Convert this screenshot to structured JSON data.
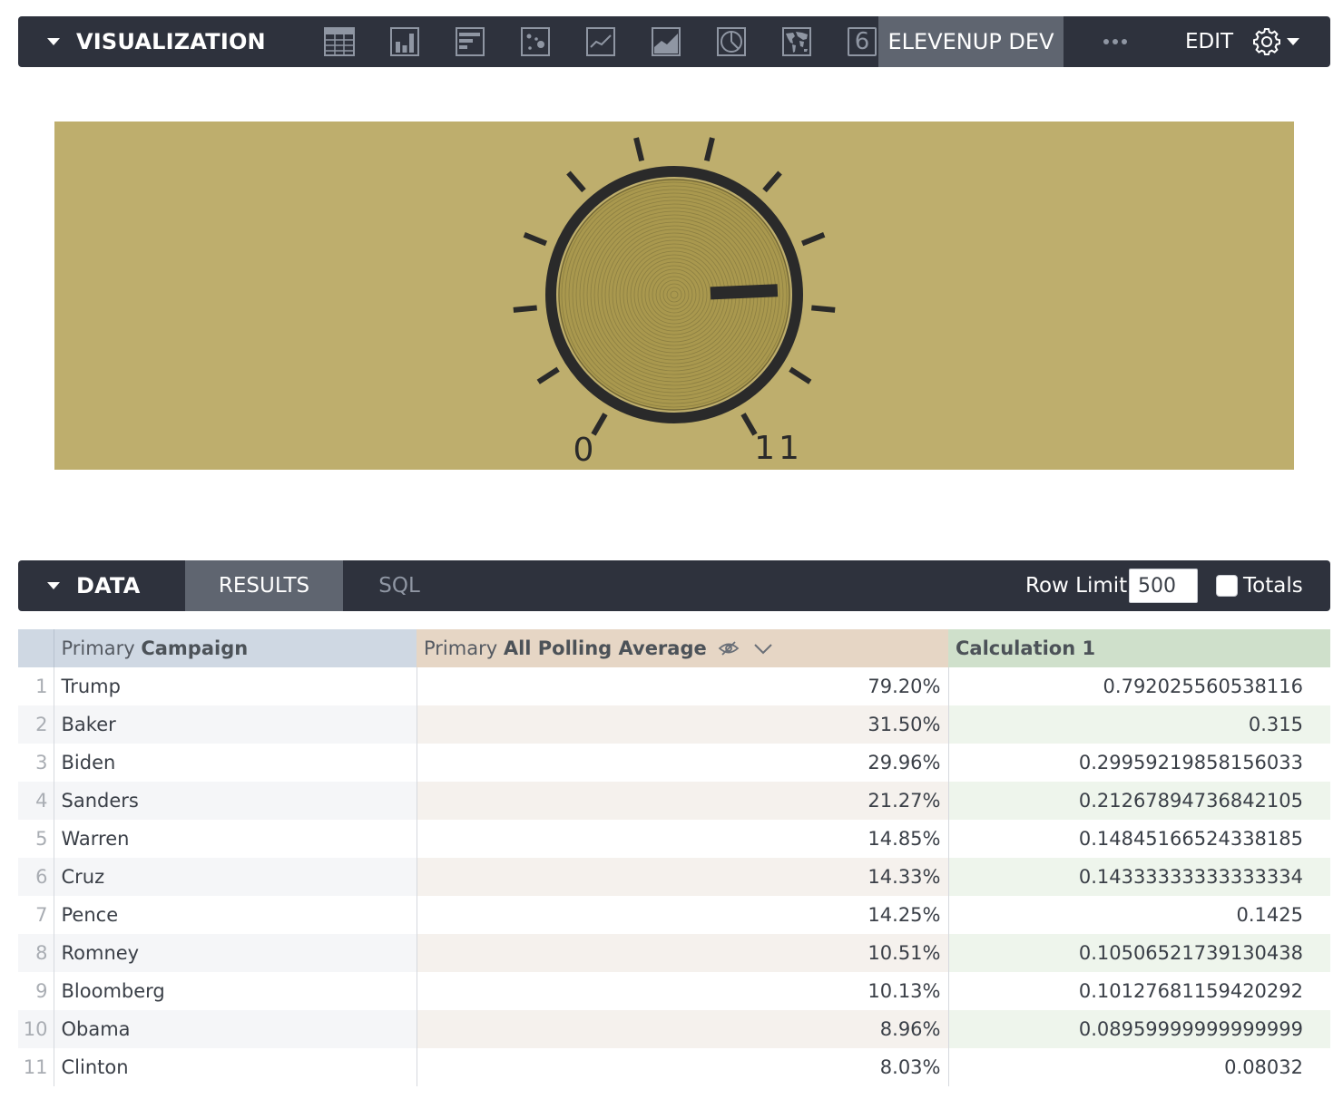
{
  "visualization_bar": {
    "title": "VISUALIZATION",
    "icons": [
      "table-icon",
      "column-chart-icon",
      "bar-chart-icon",
      "scatter-icon",
      "line-chart-icon",
      "area-chart-icon",
      "pie-chart-icon",
      "map-icon",
      "single-value-icon"
    ],
    "single_value_glyph": "6",
    "active_vis": "ELEVENUP DEV",
    "edit_label": "EDIT"
  },
  "gauge": {
    "min_label": "0",
    "max_label": "11",
    "value": 0.792,
    "colors": {
      "background": "#beae6d",
      "knob": "#a9984e",
      "ring": "#2a2a2a"
    }
  },
  "data_bar": {
    "title": "DATA",
    "tabs": [
      "RESULTS",
      "SQL"
    ],
    "row_limit_label": "Row Limit",
    "row_limit_value": "500",
    "totals_label": "Totals"
  },
  "table": {
    "headers": {
      "dim_prefix": "Primary ",
      "dim_name": "Campaign",
      "meas_prefix": "Primary ",
      "meas_name": "All Polling Average",
      "calc_name": "Calculation 1"
    },
    "rows": [
      {
        "num": "1",
        "campaign": "Trump",
        "avg": "79.20%",
        "calc": "0.792025560538116"
      },
      {
        "num": "2",
        "campaign": "Baker",
        "avg": "31.50%",
        "calc": "0.315"
      },
      {
        "num": "3",
        "campaign": "Biden",
        "avg": "29.96%",
        "calc": "0.29959219858156033"
      },
      {
        "num": "4",
        "campaign": "Sanders",
        "avg": "21.27%",
        "calc": "0.21267894736842105"
      },
      {
        "num": "5",
        "campaign": "Warren",
        "avg": "14.85%",
        "calc": "0.14845166524338185"
      },
      {
        "num": "6",
        "campaign": "Cruz",
        "avg": "14.33%",
        "calc": "0.14333333333333334"
      },
      {
        "num": "7",
        "campaign": "Pence",
        "avg": "14.25%",
        "calc": "0.1425"
      },
      {
        "num": "8",
        "campaign": "Romney",
        "avg": "10.51%",
        "calc": "0.10506521739130438"
      },
      {
        "num": "9",
        "campaign": "Bloomberg",
        "avg": "10.13%",
        "calc": "0.10127681159420292"
      },
      {
        "num": "10",
        "campaign": "Obama",
        "avg": "8.96%",
        "calc": "0.08959999999999999"
      },
      {
        "num": "11",
        "campaign": "Clinton",
        "avg": "8.03%",
        "calc": "0.08032"
      }
    ]
  },
  "colors": {
    "bar_bg": "#2e323d",
    "active_tab": "#5f6570",
    "dim_header": "#cfd8e3",
    "meas_header": "#e6d6c5",
    "calc_header": "#cfe0cb"
  }
}
